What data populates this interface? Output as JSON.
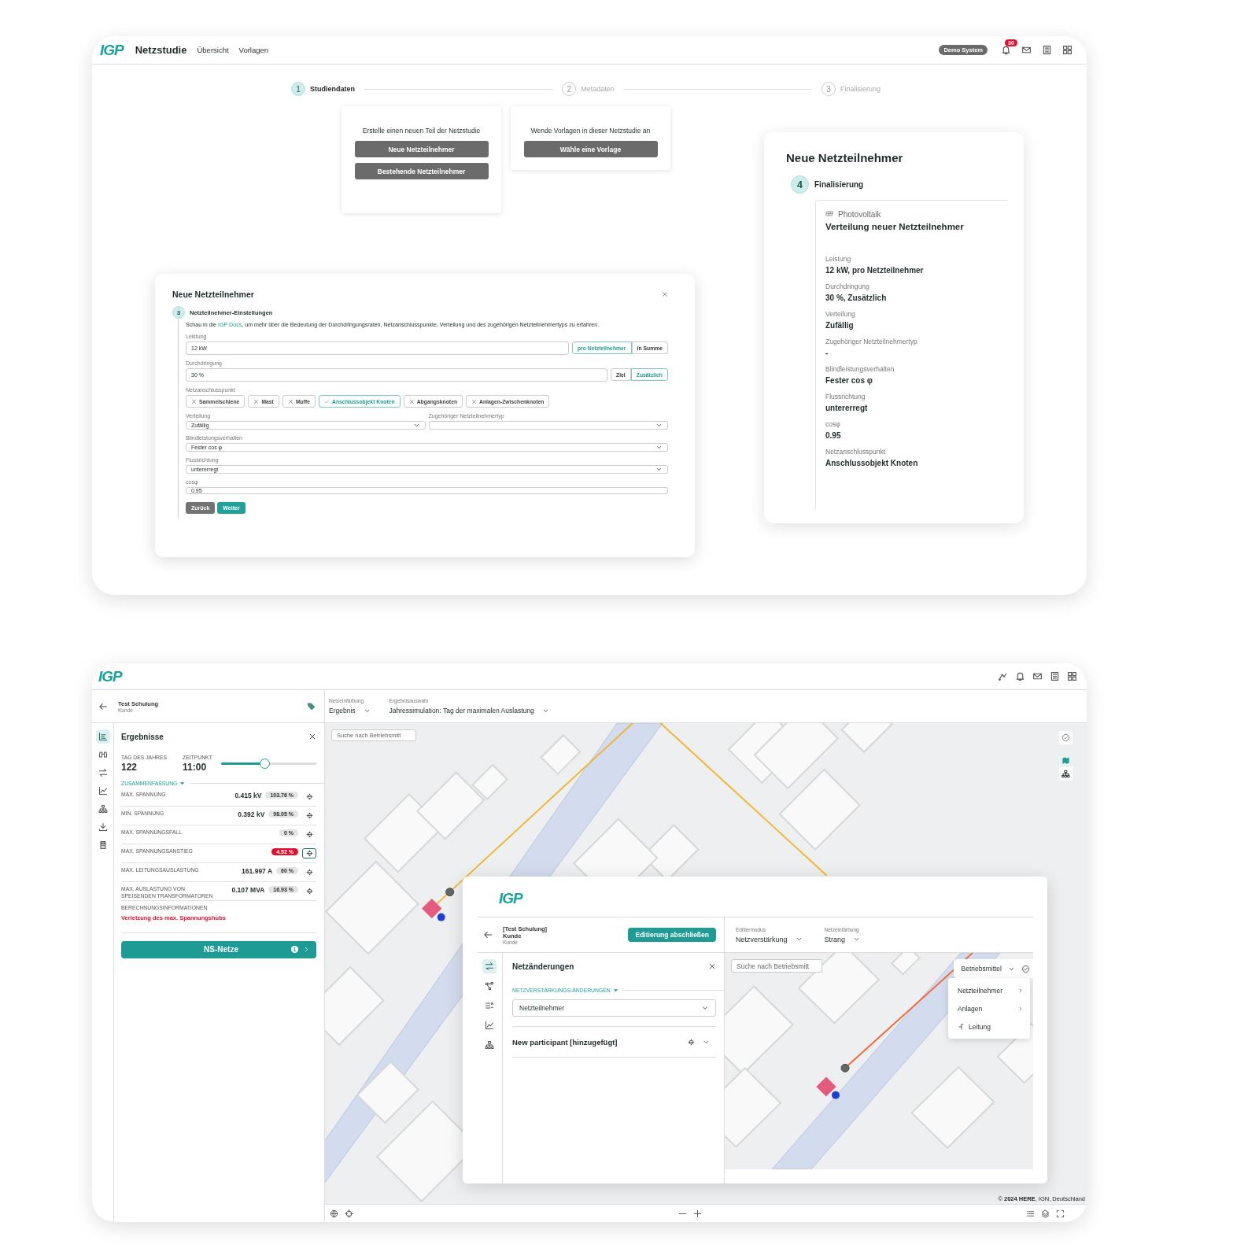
{
  "study_screen": {
    "header": {
      "logo": "IGP",
      "title": "Netzstudie",
      "nav": [
        "Übersicht",
        "Vorlagen"
      ],
      "system_badge": "Demo System",
      "notification_count": "30"
    },
    "steps": [
      {
        "number": "1",
        "label": "Studiendaten",
        "selected": true
      },
      {
        "number": "2",
        "label": "Metadaten",
        "selected": false
      },
      {
        "number": "3",
        "label": "Finalisierung",
        "selected": false
      }
    ],
    "options": [
      {
        "text": "Erstelle einen neuen Teil der Netzstudie",
        "buttons": [
          "Neue Netzteilnehmer",
          "Bestehende Netzteilnehmer"
        ]
      },
      {
        "text": "Wende Vorlagen in dieser Netzstudie an",
        "buttons": [
          "Wähle eine Vorlage"
        ]
      }
    ],
    "dialog": {
      "title": "Neue Netzteilnehmer",
      "step": {
        "number": "3",
        "label": "Netzteilnehmer-Einstellungen"
      },
      "intro": {
        "before": "Schau in die ",
        "link": "IGP Docs",
        "after": ", um mehr über die Bedeutung der Durchdringungsraten, Netzanschlusspunkte, Verteilung und des zugehörigen Netzteilnehmertyps zu erfahren."
      },
      "power": {
        "label": "Leistung",
        "value": "12 kW",
        "options": [
          {
            "label": "pro Netzteilnehmer",
            "selected": true
          },
          {
            "label": "in Summe",
            "selected": false
          }
        ]
      },
      "penetration": {
        "label": "Durchdringung",
        "value": "30 %",
        "options": [
          {
            "label": "Ziel",
            "selected": false
          },
          {
            "label": "Zusätzlich",
            "selected": true
          }
        ]
      },
      "connection_points": {
        "label": "Netzanschlusspunkt",
        "chips": [
          {
            "label": "Sammelschiene",
            "selected": false
          },
          {
            "label": "Mast",
            "selected": false
          },
          {
            "label": "Muffe",
            "selected": false
          },
          {
            "label": "Anschlussobjekt Knoten",
            "selected": true
          },
          {
            "label": "Abgangsknoten",
            "selected": false
          },
          {
            "label": "Anlagen-Zwischenknoten",
            "selected": false
          }
        ]
      },
      "distribution": {
        "label": "Verteilung",
        "value": "Zufällig"
      },
      "participant_type": {
        "label": "Zugehöriger Netzteilnehmertyp"
      },
      "reactive_power": {
        "label": "Blindleistungsverhalten",
        "value": "Fester cos φ"
      },
      "flow_direction": {
        "label": "Flussrichtung",
        "value": "untererregt"
      },
      "cos_phi": {
        "label": "cosφ",
        "value": "0,95"
      },
      "buttons": [
        {
          "label": "Zurück",
          "kind": "secondary"
        },
        {
          "label": "Weiter",
          "kind": "primary"
        }
      ]
    },
    "summary": {
      "title": "Neue Netzteilnehmer",
      "step": {
        "number": "4",
        "label": "Finalisierung"
      },
      "category": "Photovoltaik",
      "heading": "Verteilung neuer Netzteilnehmer",
      "items": [
        {
          "label": "Leistung",
          "value": "12 kW, pro Netzteilnehmer"
        },
        {
          "label": "Durchdringung",
          "value": "30 %, Zusätzlich"
        },
        {
          "label": "Verteilung",
          "value": "Zufällig"
        },
        {
          "label": "Zugehöriger Netzteilnehmertyp",
          "value": "-"
        },
        {
          "label": "Blindleistungsverhalten",
          "value": "Fester cos φ"
        },
        {
          "label": "Flussrichtung",
          "value": "untererregt"
        },
        {
          "label": "cosφ",
          "value": "0.95"
        },
        {
          "label": "Netzanschlusspunkt",
          "value": "Anschlussobjekt Knoten"
        }
      ]
    }
  },
  "results_screen": {
    "header": {
      "logo": "IGP"
    },
    "project": {
      "title": "Test Schulung",
      "subtitle": "Kunde"
    },
    "toolbar": [
      {
        "label": "Netzeinfärbung",
        "value": "Ergebnis"
      },
      {
        "label": "Ergebnisauswahl",
        "value": "Jahressimulation: Tag der maximalen Auslastung"
      }
    ],
    "rail": [
      {
        "kind": "results",
        "selected": true
      },
      {
        "kind": "binoculars",
        "selected": false
      },
      {
        "kind": "transfer",
        "selected": false
      },
      {
        "kind": "line-chart",
        "selected": false
      },
      {
        "kind": "hierarchy",
        "selected": false
      },
      {
        "kind": "download",
        "selected": false
      },
      {
        "kind": "calculator",
        "selected": false
      }
    ],
    "panel": {
      "title": "Ergebnisse",
      "day": {
        "label": "TAG DES JAHRES",
        "value": "122"
      },
      "time": {
        "label": "ZEITPUNKT",
        "value": "11:00"
      },
      "slider": {
        "level": 0.46
      },
      "section": "ZUSAMMENFASSUNG",
      "metrics": [
        {
          "label": "MAX. SPANNUNG",
          "value": "0.415 kV",
          "percent": "103.76 %",
          "alert": false,
          "selected": false
        },
        {
          "label": "MIN. SPANNUNG",
          "value": "0.392 kV",
          "percent": "98.05 %",
          "alert": false,
          "selected": false
        },
        {
          "label": "MAX. SPANNUNGSFALL",
          "percent": "0 %",
          "alert": false,
          "selected": false
        },
        {
          "label": "MAX. SPANNUNGSANSTIEG",
          "percent": "4.52 %",
          "alert": true,
          "selected": true
        },
        {
          "label": "MAX. LEITUNGSAUSLASTUNG",
          "value": "161.997 A",
          "percent": "60 %",
          "alert": false,
          "selected": false
        },
        {
          "label": "MAX. AUSLASTUNG VON SPEISENDEN TRANSFORMATOREN",
          "value": "0.107 MVA",
          "percent": "16.93 %",
          "alert": false,
          "selected": false
        }
      ],
      "info": {
        "label": "BERECHNUNGSINFORMATIONEN",
        "message": "Verletzung des max. Spannungshubs"
      },
      "networks_button": {
        "label": "NS-Netze",
        "count": "1"
      }
    },
    "map": {
      "search_placeholder": "Suche nach Betriebsmitt",
      "attribution": "© **2024 HERE**, IGN, Deutschland"
    },
    "editor": {
      "logo": "IGP",
      "project": {
        "title": "[Test Schulung] Kunde",
        "subtitle": "Kunde"
      },
      "finish_button": "Editierung abschließen",
      "toolbar": [
        {
          "label": "Editiermodus",
          "value": "Netzverstärkung"
        },
        {
          "label": "Netzeinfärbung",
          "value": "Strang"
        }
      ],
      "rail": [
        {
          "kind": "transfer",
          "selected": true
        },
        {
          "kind": "nodes",
          "selected": false
        },
        {
          "kind": "list-settings",
          "selected": false
        },
        {
          "kind": "line-chart",
          "selected": false
        },
        {
          "kind": "hierarchy",
          "selected": false
        }
      ],
      "panel": {
        "title": "Netzänderungen",
        "section": "NETZVERSTÄRKUNGS-ÄNDERUNGEN",
        "select": "Netzteilnehmer",
        "changes": [
          {
            "label": "New participant [hinzugefügt]",
            "expanded": false
          }
        ]
      },
      "map": {
        "search_placeholder": "Suche nach Betriebsmitt",
        "layer_select": "Betriebsmittel",
        "menu": [
          {
            "label": "Netzteilnehmer",
            "kind": "submenu"
          },
          {
            "label": "Anlagen",
            "kind": "submenu"
          },
          {
            "label": "Leitung",
            "kind": "line"
          }
        ]
      }
    }
  }
}
